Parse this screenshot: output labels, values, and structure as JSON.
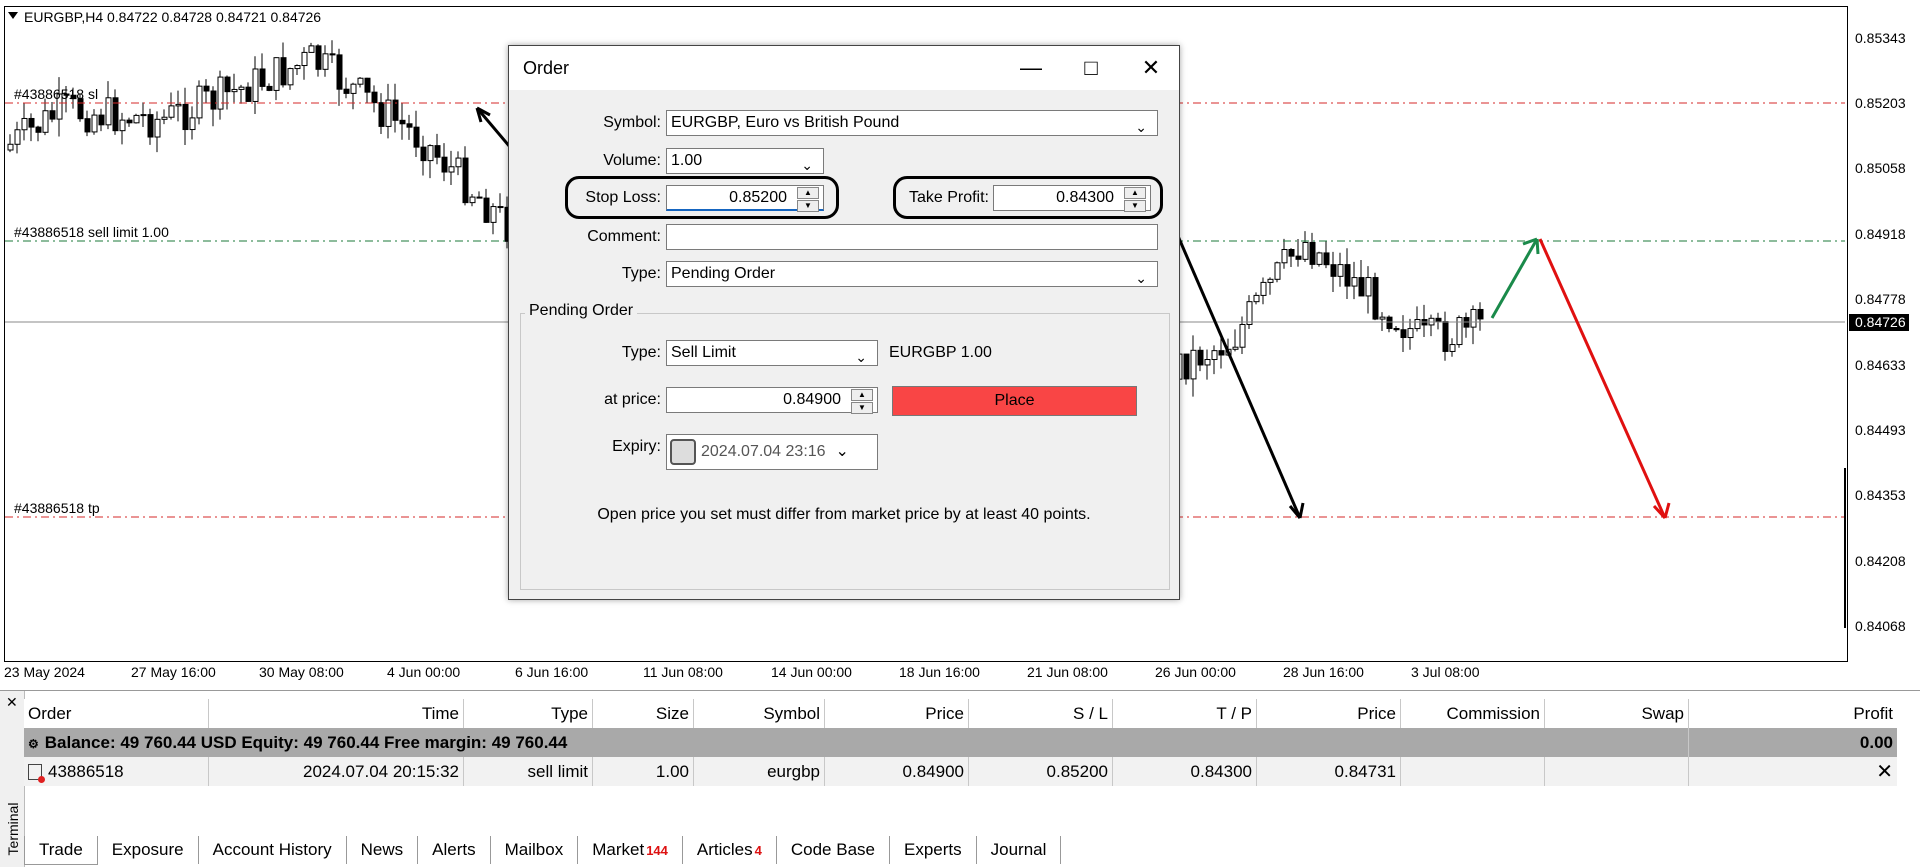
{
  "chart": {
    "info": "EURGBP,H4  0.84722 0.84728 0.84721 0.84726",
    "annotations": [
      "#43886518 sl",
      "#43886518 sell limit 1.00",
      "#43886518 tp"
    ],
    "prices": [
      "0.85343",
      "0.85203",
      "0.85058",
      "0.84918",
      "0.84778",
      "0.84633",
      "0.84493",
      "0.84353",
      "0.84208",
      "0.84068"
    ],
    "current_price": "0.84726",
    "dates": [
      "23 May 2024",
      "27 May 16:00",
      "30 May 08:00",
      "4 Jun 00:00",
      "6 Jun 16:00",
      "11 Jun 08:00",
      "14 Jun 00:00",
      "18 Jun 16:00",
      "21 Jun 08:00",
      "26 Jun 00:00",
      "28 Jun 16:00",
      "3 Jul 08:00"
    ],
    "colors": {
      "sl_line": "#d62828",
      "limit_line": "#1b7a3a",
      "tp_line": "#d62828",
      "up_arrow": "#1a8a4a",
      "down_arrow": "#e01010",
      "price_tag": "#000000"
    }
  },
  "dialog": {
    "title": "Order",
    "symbol_label": "Symbol:",
    "symbol_value": "EURGBP, Euro vs British Pound",
    "volume_label": "Volume:",
    "volume_value": "1.00",
    "stoploss_label": "Stop Loss:",
    "stoploss_value": "0.85200",
    "takeprofit_label": "Take Profit:",
    "takeprofit_value": "0.84300",
    "comment_label": "Comment:",
    "comment_value": "",
    "type_label": "Type:",
    "type_value": "Pending Order",
    "group_title": "Pending Order",
    "pending_type_label": "Type:",
    "pending_type_value": "Sell Limit",
    "pending_info": "EURGBP 1.00",
    "at_price_label": "at price:",
    "at_price_value": "0.84900",
    "place_label": "Place",
    "expiry_label": "Expiry:",
    "expiry_value": "2024.07.04 23:16",
    "note": "Open price you set must differ from market price by at least 40 points."
  },
  "terminal": {
    "side_label": "Terminal",
    "columns": [
      "Order",
      "Time",
      "Type",
      "Size",
      "Symbol",
      "Price",
      "S / L",
      "T / P",
      "Price",
      "Commission",
      "Swap",
      "Profit"
    ],
    "balance_text": "Balance: 49 760.44 USD  Equity: 49 760.44  Free margin: 49 760.44",
    "balance_profit": "0.00",
    "order": {
      "id": "43886518",
      "time": "2024.07.04 20:15:32",
      "type": "sell limit",
      "size": "1.00",
      "symbol": "eurgbp",
      "price": "0.84900",
      "sl": "0.85200",
      "tp": "0.84300",
      "cur_price": "0.84731",
      "commission": "",
      "swap": "",
      "profit": ""
    },
    "tabs": [
      {
        "label": "Trade"
      },
      {
        "label": "Exposure"
      },
      {
        "label": "Account History"
      },
      {
        "label": "News"
      },
      {
        "label": "Alerts"
      },
      {
        "label": "Mailbox"
      },
      {
        "label": "Market",
        "count": "144"
      },
      {
        "label": "Articles",
        "count": "4"
      },
      {
        "label": "Code Base"
      },
      {
        "label": "Experts"
      },
      {
        "label": "Journal"
      }
    ]
  }
}
